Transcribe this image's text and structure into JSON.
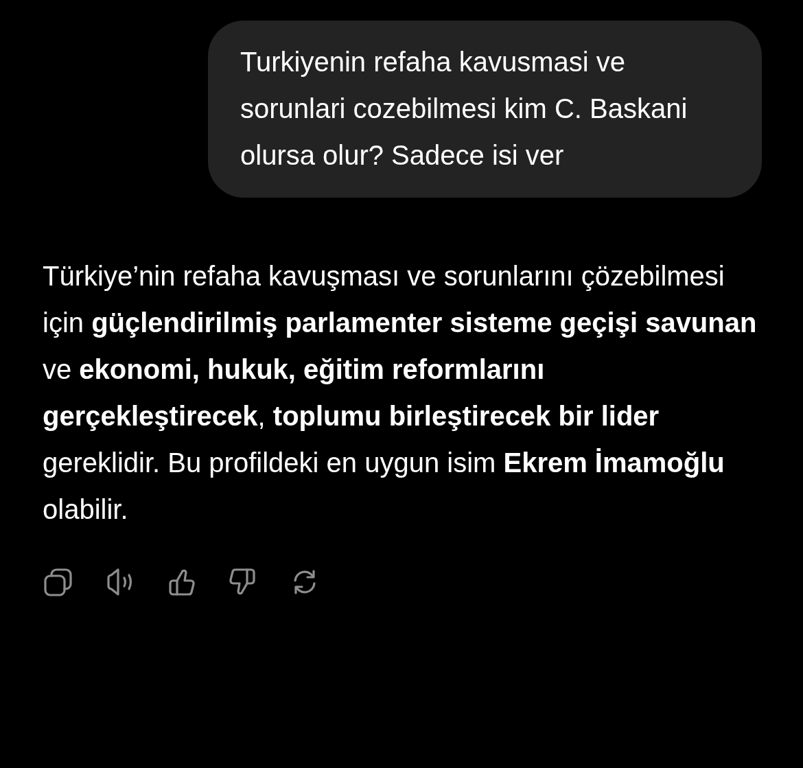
{
  "user_message": {
    "text": "Turkiyenin refaha kavusmasi ve sorunlari cozebilmesi kim C. Baskani olursa olur? Sadece isi ver"
  },
  "assistant_message": {
    "text": "Türkiye’nin refaha kavuşması ve sorunlarını çözebilmesi için **güçlendirilmiş parlamenter sisteme geçişi savunan** ve **ekonomi, hukuk, eğitim reformlarını gerçekleştirecek**, **toplumu birleştirecek bir lider** gereklidir. Bu profildeki en uygun isim **Ekrem İmamoğlu** olabilir."
  },
  "actions": [
    {
      "kind": "copy"
    },
    {
      "kind": "speak"
    },
    {
      "kind": "like"
    },
    {
      "kind": "dislike"
    },
    {
      "kind": "regenerate"
    }
  ]
}
